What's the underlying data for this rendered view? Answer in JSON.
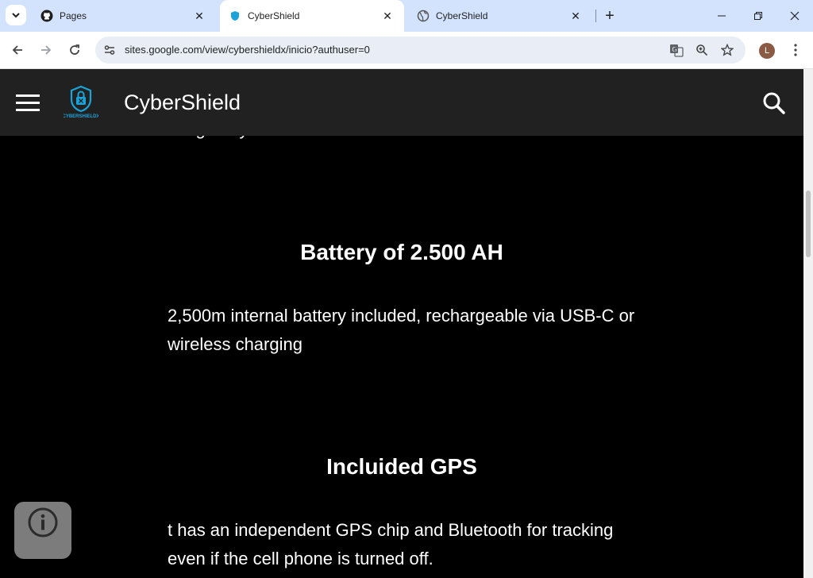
{
  "browser": {
    "tabs": [
      {
        "title": "Pages",
        "active": false
      },
      {
        "title": "CyberShield",
        "active": true
      },
      {
        "title": "CyberShield",
        "active": false
      }
    ],
    "url": "sites.google.com/view/cybershieldx/inicio?authuser=0",
    "profile_initial": "L"
  },
  "site": {
    "title": "CyberShield",
    "logo_text": "CYBERSHIELDX"
  },
  "content": {
    "cut_text": "image of your choice",
    "sections": [
      {
        "heading": "Battery of 2.500 AH",
        "text": "2,500m internal battery included, rechargeable via USB-C or wireless charging"
      },
      {
        "heading": "Incluided GPS",
        "text": "t has an independent GPS chip and Bluetooth for tracking even if the cell phone is turned off."
      }
    ]
  },
  "colors": {
    "header_bg": "#212121",
    "page_bg": "#000000",
    "tabbar_bg": "#d3e3fd",
    "logo_accent": "#1aa3d9"
  }
}
